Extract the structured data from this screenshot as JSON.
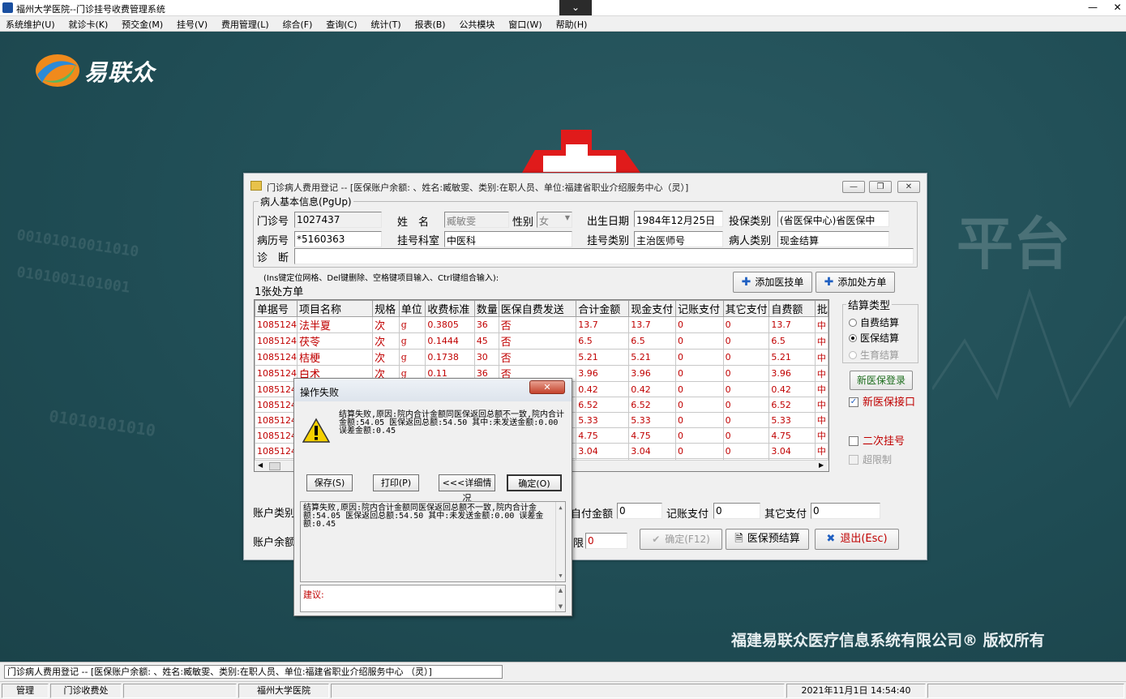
{
  "window": {
    "title": "福州大学医院--门诊挂号收费管理系统"
  },
  "menu": [
    "系统维护(U)",
    "就诊卡(K)",
    "预交金(M)",
    "挂号(V)",
    "费用管理(L)",
    "综合(F)",
    "查询(C)",
    "统计(T)",
    "报表(B)",
    "公共模块",
    "窗口(W)",
    "帮助(H)"
  ],
  "desktop": {
    "logo_text": "易联众",
    "copyright": "福建易联众医疗信息系统有限公司® 版权所有",
    "watermark": "平台",
    "binary1": "00101010011010",
    "binary2": "0101001101001",
    "binary3": "01010101010"
  },
  "dialog": {
    "title": "门诊病人费用登记 -- [医保账户余额: 、姓名:臧敏雯、类别:在职人员、单位:福建省职业介绍服务中心（灵）]",
    "patient_group": "病人基本信息(PgUp)",
    "labels": {
      "clinic_no": "门诊号",
      "name": "姓　名",
      "gender": "性别",
      "dob": "出生日期",
      "insure_type": "投保类别",
      "record_no": "病历号",
      "dept": "挂号科室",
      "reg_type": "挂号类别",
      "patient_type": "病人类别",
      "diagnosis": "诊　断"
    },
    "values": {
      "clinic_no": "1027437",
      "name": "臧敏雯",
      "gender": "女",
      "dob": "1984年12月25日",
      "insure_type": "(省医保中心)省医保中",
      "record_no": "*5160363",
      "dept": "中医科",
      "reg_type": "主治医师号",
      "patient_type": "现金结算",
      "diagnosis": ""
    },
    "hint": "(Ins键定位网格、Del键删除、空格键项目输入、Ctrl键组合输入):",
    "prescription_count": "1张处方单",
    "add_tech_button": "添加医技单",
    "add_rx_button": "添加处方单",
    "columns": [
      "单据号",
      "项目名称",
      "规格",
      "单位",
      "收费标准",
      "数量",
      "医保自费发送",
      "合计金额",
      "现金支付",
      "记账支付",
      "其它支付",
      "自费额",
      "批"
    ],
    "rows": [
      [
        "1085124",
        "法半夏",
        "次",
        "g",
        "0.3805",
        "36",
        "否",
        "13.7",
        "13.7",
        "0",
        "0",
        "13.7",
        "中"
      ],
      [
        "1085124",
        "茯苓",
        "次",
        "g",
        "0.1444",
        "45",
        "否",
        "6.5",
        "6.5",
        "0",
        "0",
        "6.5",
        "中"
      ],
      [
        "1085124",
        "桔梗",
        "次",
        "g",
        "0.1738",
        "30",
        "否",
        "5.21",
        "5.21",
        "0",
        "0",
        "5.21",
        "中"
      ],
      [
        "1085124",
        "白术",
        "次",
        "g",
        "0.11",
        "36",
        "否",
        "3.96",
        "3.96",
        "0",
        "0",
        "3.96",
        "中"
      ],
      [
        "1085124",
        "",
        "",
        "",
        "",
        "",
        "",
        "0.42",
        "0.42",
        "0",
        "0",
        "0.42",
        "中"
      ],
      [
        "1085124",
        "",
        "",
        "",
        "",
        "",
        "",
        "6.52",
        "6.52",
        "0",
        "0",
        "6.52",
        "中"
      ],
      [
        "1085124",
        "",
        "",
        "",
        "",
        "",
        "",
        "5.33",
        "5.33",
        "0",
        "0",
        "5.33",
        "中"
      ],
      [
        "1085124",
        "",
        "",
        "",
        "",
        "",
        "",
        "4.75",
        "4.75",
        "0",
        "0",
        "4.75",
        "中"
      ],
      [
        "1085124",
        "",
        "",
        "",
        "",
        "",
        "",
        "3.04",
        "3.04",
        "0",
        "0",
        "3.04",
        "中"
      ]
    ],
    "settle_group": "结算类型",
    "settle_options": [
      "自费结算",
      "医保结算",
      "生育结算"
    ],
    "new_insure_login": "新医保登录",
    "new_insure_interface": "新医保接口",
    "second_reg": "二次挂号",
    "over_limit": "超限制",
    "bottom_labels": {
      "account_type": "账户类别",
      "self_amount": "自付金额",
      "acct_pay": "记账支付",
      "other_pay": "其它支付",
      "account_balance": "账户余额",
      "limit": "限"
    },
    "bottom_values": {
      "self_amount": "0",
      "acct_pay": "0",
      "other_pay": "0",
      "limit": "0"
    },
    "confirm_button": "确定(F12)",
    "presettle_button": "医保预结算",
    "exit_button": "退出(Esc)"
  },
  "error": {
    "title": "操作失败",
    "message": "结算失败,原因:院内合计金额同医保返回总额不一致,院内合计金额:54.05 医保返回总额:54.50 其中:未发送金额:0.00 误差金额:0.45",
    "buttons": [
      "保存(S)",
      "打印(P)",
      "<<<详细情况",
      "确定(O)"
    ],
    "detail": "结算失败,原因:院内合计金额同医保返回总额不一致,院内合计金额:54.05 医保返回总额:54.50 其中:未发送金额:0.00 误差金额:0.45",
    "suggestion": "建议:"
  },
  "taskline": "门诊病人费用登记 -- [医保账户余额: 、姓名:臧敏雯、类别:在职人员、单位:福建省职业介绍服务中心 （灵）]",
  "status": {
    "user": "管理",
    "office": "门诊收费处",
    "hospital": "福州大学医院",
    "datetime": "2021年11月1日 14:54:40"
  }
}
